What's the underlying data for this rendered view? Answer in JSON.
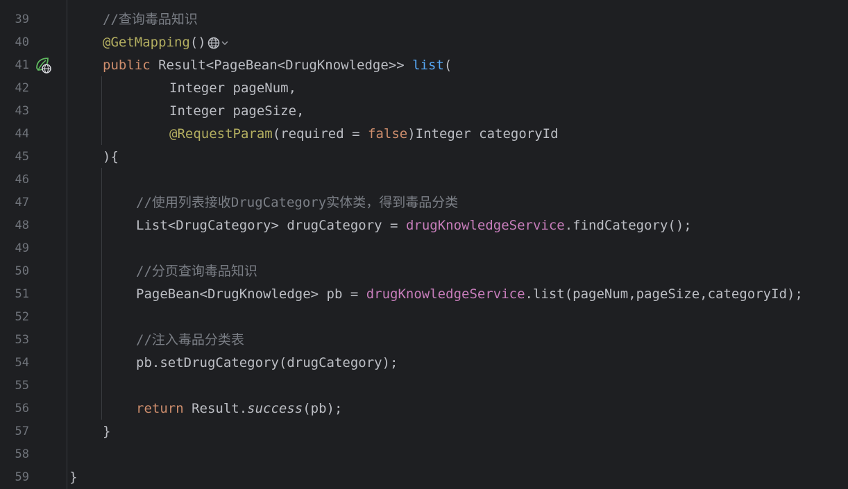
{
  "editor": {
    "lines": [
      {
        "n": "39",
        "tokens": [
          [
            "cmt",
            "//"
          ],
          [
            "cmt cjk",
            "查询毒品知识"
          ]
        ]
      },
      {
        "n": "40",
        "tokens": [
          [
            "ann",
            "@GetMapping"
          ],
          [
            "",
            "()"
          ]
        ],
        "web_icon": "globe-icon"
      },
      {
        "n": "41",
        "tokens": [
          [
            "kw",
            "public "
          ],
          [
            "",
            "Result<PageBean<DrugKnowledge>> "
          ],
          [
            "fn",
            "list"
          ],
          [
            "",
            "("
          ]
        ],
        "gutter_icon": "spring-web-endpoint-icon"
      },
      {
        "n": "42",
        "tokens": [
          [
            "",
            "Integer pageNum,"
          ]
        ]
      },
      {
        "n": "43",
        "tokens": [
          [
            "",
            "Integer pageSize,"
          ]
        ]
      },
      {
        "n": "44",
        "tokens": [
          [
            "ann",
            "@RequestParam"
          ],
          [
            "",
            "(required = "
          ],
          [
            "kw",
            "false"
          ],
          [
            "",
            ")Integer categoryId"
          ]
        ]
      },
      {
        "n": "45",
        "tokens": [
          [
            "",
            "){"
          ]
        ]
      },
      {
        "n": "46",
        "tokens": []
      },
      {
        "n": "47",
        "tokens": [
          [
            "cmt",
            "//"
          ],
          [
            "cmt cjk",
            "使用列表接收"
          ],
          [
            "cmt",
            "DrugCategory"
          ],
          [
            "cmt cjk",
            "实体类，得到毒品分类"
          ]
        ]
      },
      {
        "n": "48",
        "tokens": [
          [
            "",
            "List<DrugCategory> drugCategory = "
          ],
          [
            "fld",
            "drugKnowledgeService"
          ],
          [
            "",
            ".findCategory();"
          ]
        ]
      },
      {
        "n": "49",
        "tokens": []
      },
      {
        "n": "50",
        "tokens": [
          [
            "cmt",
            "//"
          ],
          [
            "cmt cjk",
            "分页查询毒品知识"
          ]
        ]
      },
      {
        "n": "51",
        "tokens": [
          [
            "",
            "PageBean<DrugKnowledge> pb = "
          ],
          [
            "fld",
            "drugKnowledgeService"
          ],
          [
            "",
            ".list(pageNum,pageSize,categoryId);"
          ]
        ]
      },
      {
        "n": "52",
        "tokens": []
      },
      {
        "n": "53",
        "tokens": [
          [
            "cmt",
            "//"
          ],
          [
            "cmt cjk",
            "注入毒品分类表"
          ]
        ]
      },
      {
        "n": "54",
        "tokens": [
          [
            "",
            "pb.setDrugCategory(drugCategory);"
          ]
        ]
      },
      {
        "n": "55",
        "tokens": []
      },
      {
        "n": "56",
        "tokens": [
          [
            "kw",
            "return "
          ],
          [
            "",
            "Result."
          ],
          [
            "it",
            "success"
          ],
          [
            "",
            "(pb);"
          ]
        ]
      },
      {
        "n": "57",
        "tokens": [
          [
            "",
            "}"
          ]
        ]
      },
      {
        "n": "58",
        "tokens": []
      },
      {
        "n": "59",
        "tokens": [
          [
            "",
            "}"
          ]
        ]
      }
    ]
  },
  "colors": {
    "background": "#1e1f22",
    "comment": "#7a7e85",
    "annotation": "#b3ae60",
    "keyword": "#cf8e6d",
    "function": "#56a8f5",
    "field": "#c77dbb",
    "text": "#bcbec4",
    "line_number": "#6f737a"
  }
}
